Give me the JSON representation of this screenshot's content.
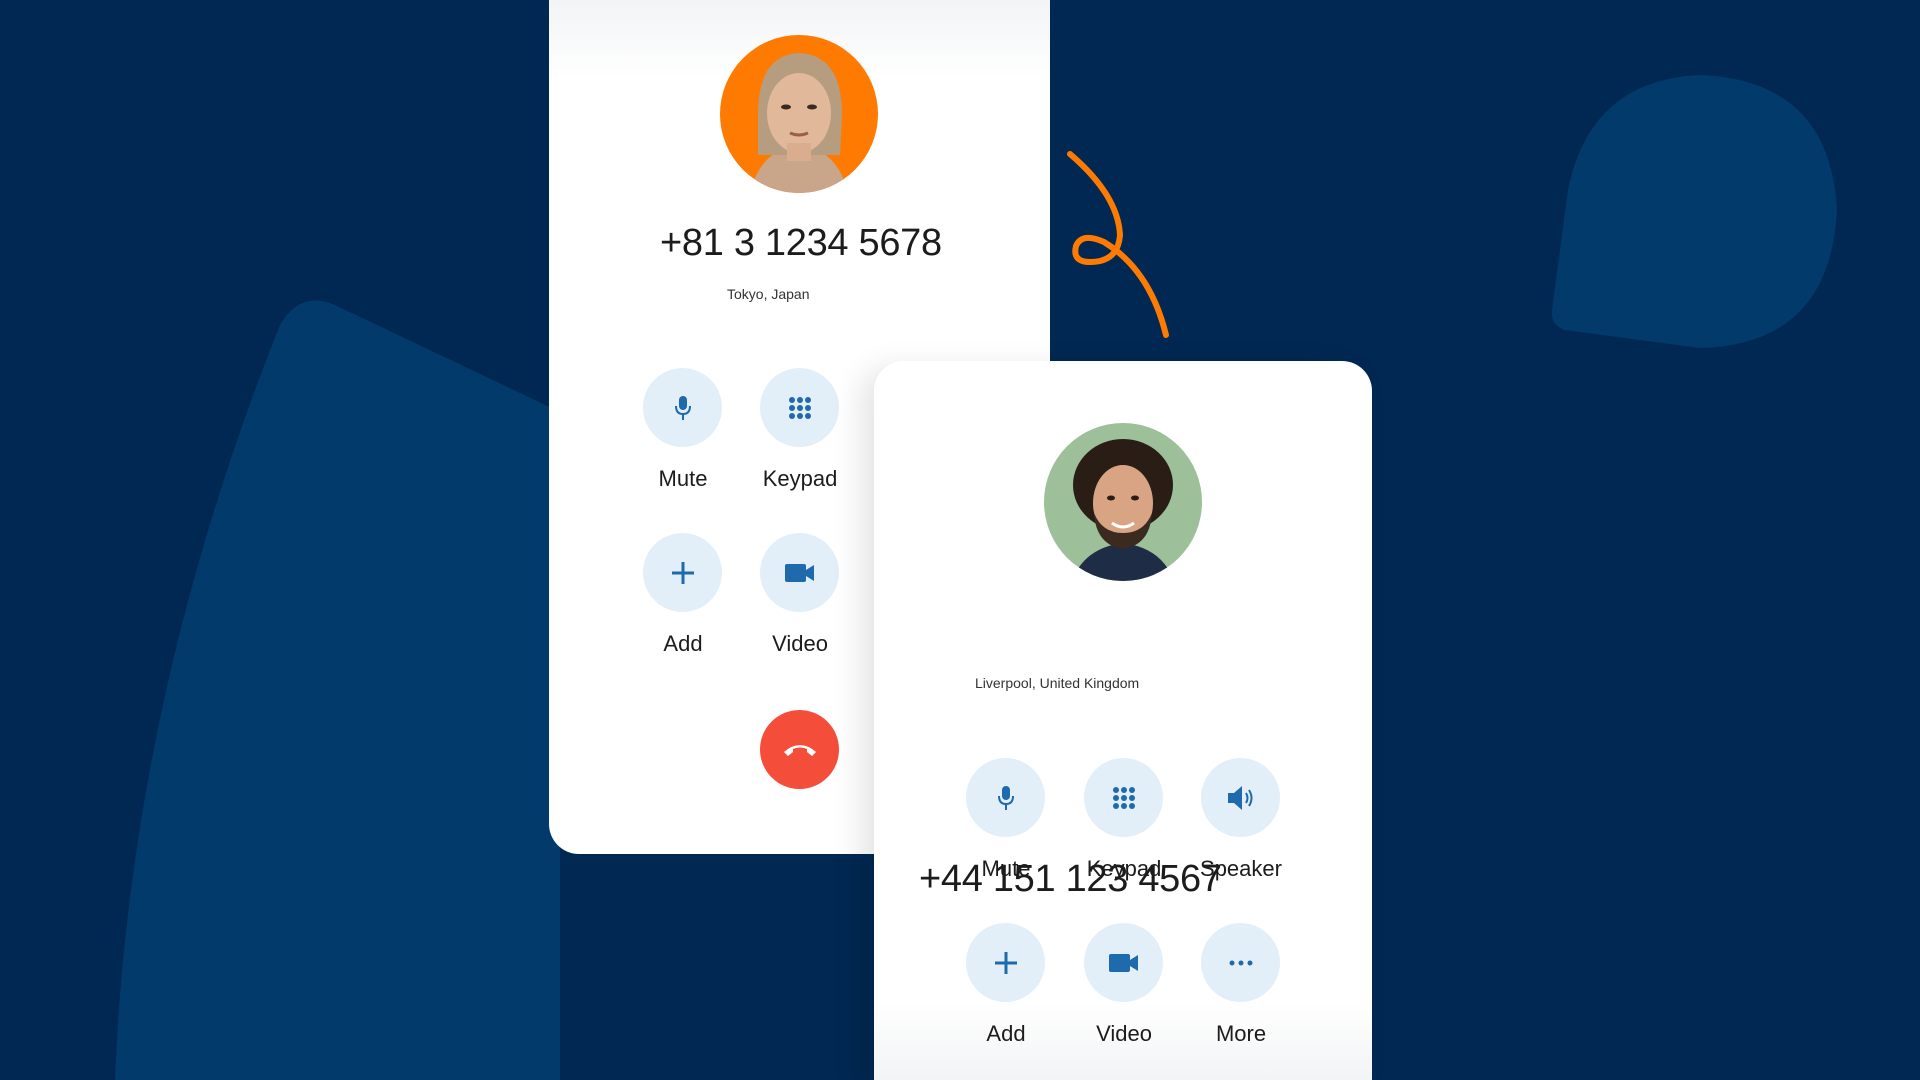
{
  "colors": {
    "background": "#002852",
    "shape": "#023a6b",
    "accent_orange": "#ff7a00",
    "button_bg": "#e3eff8",
    "icon_blue": "#1f69ad",
    "end_call_red": "#f44e3b"
  },
  "call1": {
    "avatar": "woman-avatar",
    "avatar_bg": "#ff7a00",
    "phone_number": "+81 3 1234 5678",
    "location": "Tokyo, Japan",
    "controls": [
      {
        "label": "Mute",
        "icon": "microphone-icon"
      },
      {
        "label": "Keypad",
        "icon": "keypad-icon"
      },
      {
        "label": "Add",
        "icon": "plus-icon"
      },
      {
        "label": "Video",
        "icon": "video-camera-icon"
      }
    ],
    "end_call": {
      "icon": "hang-up-icon"
    }
  },
  "call2": {
    "avatar": "man-avatar",
    "avatar_bg": "#9dbf99",
    "phone_number": "+44 151 123 4567",
    "location": "Liverpool, United Kingdom",
    "controls": [
      {
        "label": "Mute",
        "icon": "microphone-icon"
      },
      {
        "label": "Keypad",
        "icon": "keypad-icon"
      },
      {
        "label": "Speaker",
        "icon": "speaker-icon"
      },
      {
        "label": "Add",
        "icon": "plus-icon"
      },
      {
        "label": "Video",
        "icon": "video-camera-icon"
      },
      {
        "label": "More",
        "icon": "more-dots-icon"
      }
    ]
  }
}
